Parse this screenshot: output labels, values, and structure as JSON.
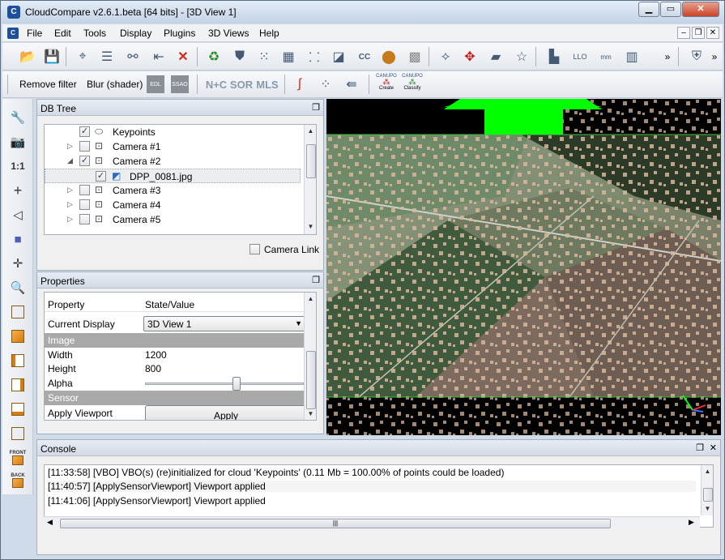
{
  "window": {
    "title": "CloudCompare v2.6.1.beta [64 bits] - [3D View 1]",
    "app_icon_glyph": "C"
  },
  "menu": [
    "File",
    "Edit",
    "Tools",
    "Display",
    "Plugins",
    "3D Views",
    "Help"
  ],
  "toolbar2": {
    "remove_filter": "Remove filter",
    "blur_shader": "Blur (shader)",
    "edl_label": "EDL",
    "ssao_label": "SSAO",
    "nc_label": "N+C",
    "sor_label": "SOR",
    "mls_label": "MLS",
    "canupo_label": "CANUPO",
    "create_label": "Create",
    "classify_label": "Classify"
  },
  "left_toolbar": {
    "zoom_one": "1:1",
    "front_label": "FRONT",
    "back_label": "BACK"
  },
  "db_tree": {
    "title": "DB Tree",
    "items": [
      {
        "label": "Keypoints",
        "checked": true,
        "arrow": "",
        "icon": "cloud-icon"
      },
      {
        "label": "Camera #1",
        "checked": false,
        "arrow": "▷",
        "icon": "camera-icon"
      },
      {
        "label": "Camera #2",
        "checked": true,
        "arrow": "◢",
        "icon": "camera-icon"
      },
      {
        "label": "DPP_0081.jpg",
        "checked": true,
        "arrow": "",
        "icon": "image-icon"
      },
      {
        "label": "Camera #3",
        "checked": false,
        "arrow": "▷",
        "icon": "camera-icon"
      },
      {
        "label": "Camera #4",
        "checked": false,
        "arrow": "▷",
        "icon": "camera-icon"
      },
      {
        "label": "Camera #5",
        "checked": false,
        "arrow": "▷",
        "icon": "camera-icon"
      }
    ],
    "camera_link": "Camera Link"
  },
  "properties": {
    "title": "Properties",
    "col_property": "Property",
    "col_value": "State/Value",
    "current_display_label": "Current Display",
    "current_display_value": "3D View 1",
    "section_image": "Image",
    "width_label": "Width",
    "width_value": "1200",
    "height_label": "Height",
    "height_value": "800",
    "alpha_label": "Alpha",
    "section_sensor": "Sensor",
    "apply_viewport_label": "Apply Viewport",
    "apply_button": "Apply"
  },
  "console": {
    "title": "Console",
    "lines": [
      "[11:33:58] [VBO] VBO(s) (re)initialized for cloud 'Keypoints' (0.11 Mb = 100.00% of points could be loaded)",
      "[11:40:57] [ApplySensorViewport] Viewport applied",
      "[11:41:06] [ApplySensorViewport] Viewport applied"
    ]
  },
  "colors": {
    "accent_green": "#00ff00",
    "point_color": "#d9b79a"
  }
}
